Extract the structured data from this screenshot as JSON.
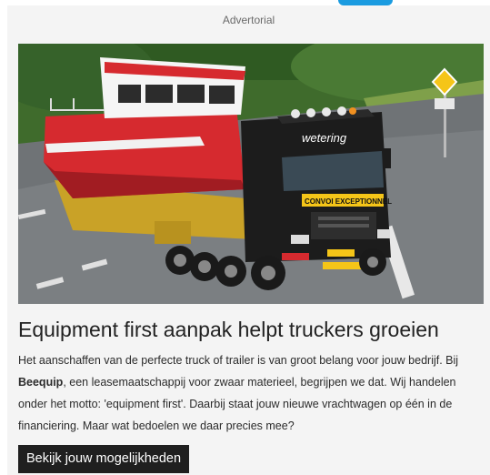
{
  "colors": {
    "accent": "#1a9be0",
    "card_background": "#f4f4f4",
    "button_background": "#1f1f1f",
    "button_text": "#ffffff"
  },
  "ad": {
    "label": "Advertorial",
    "headline": "Equipment first aanpak helpt truckers groeien",
    "body": {
      "part1": "Het aanschaffen van de perfecte truck of trailer is van groot belang voor jouw bedrijf. Bij ",
      "brand": "Beequip",
      "part2": ", een leasemaatschappij voor zwaar materieel, begrijpen we dat. Wij handelen onder het motto: 'equipment first'. Daarbij staat jouw nieuwe vrachtwagen op één in de financiering. Maar wat bedoelen we daar precies mee?"
    },
    "cta_label": "Bekijk jouw mogelijkheden",
    "image": {
      "truck_brand": "wetering",
      "truck_sign": "CONVOI EXCEPTIONNEL"
    }
  }
}
